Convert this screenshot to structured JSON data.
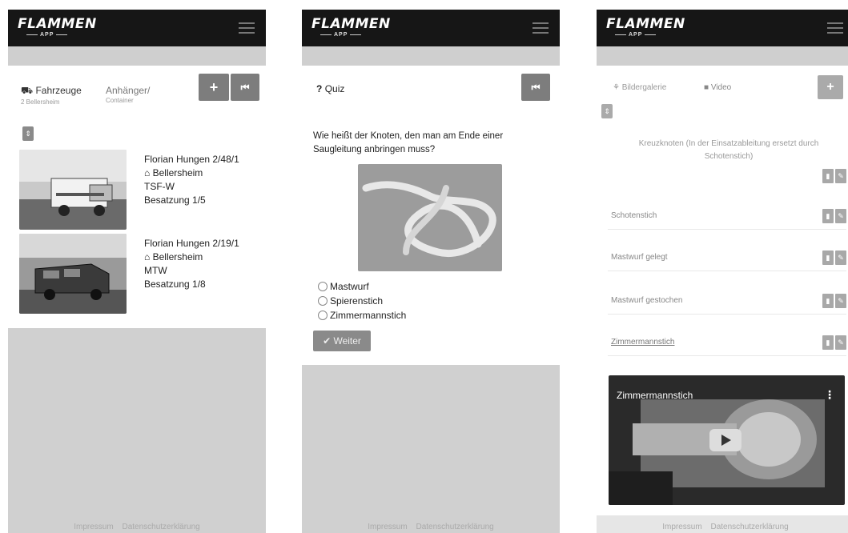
{
  "app": {
    "logo": "FLAMMEN",
    "logo_sub": "APP"
  },
  "screen1": {
    "tab_vehicles": "Fahrzeuge",
    "tab_vehicles_sub": "2 Bellersheim",
    "tab_trailers": "Anhänger/",
    "tab_trailers_sub": "Container",
    "add_label": "+",
    "back_label": "⏮",
    "toggle_label": "⇕",
    "vehicles": [
      {
        "name": "Florian Hungen 2/48/1",
        "location": "Bellersheim",
        "type": "TSF-W",
        "crew": "Besatzung 1/5"
      },
      {
        "name": "Florian Hungen 2/19/1",
        "location": "Bellersheim",
        "type": "MTW",
        "crew": "Besatzung 1/8"
      }
    ],
    "footer": [
      "Impressum",
      "Datenschutzerklärung"
    ]
  },
  "screen2": {
    "title_icon": "?",
    "title": "Quiz",
    "back_label": "⏮",
    "question": "Wie heißt der Knoten, den man am Ende einer Saugleitung anbringen muss?",
    "options": [
      "Mastwurf",
      "Spierenstich",
      "Zimmermannstich"
    ],
    "next_label": "Weiter",
    "footer": [
      "Impressum",
      "Datenschutzerklärung"
    ]
  },
  "screen3": {
    "tab_gallery": "Bildergalerie",
    "tab_video": "Video",
    "add_label": "+",
    "toggle_label": "⇕",
    "description": "Kreuzknoten (In der Einsatzableitung ersetzt durch Schotenstich)",
    "items": [
      "Schotenstich",
      "Mastwurf gelegt",
      "Mastwurf gestochen",
      "Zimmermannstich"
    ],
    "video_title": "Zimmermannstich",
    "footer": [
      "Impressum",
      "Datenschutzerklärung"
    ]
  }
}
